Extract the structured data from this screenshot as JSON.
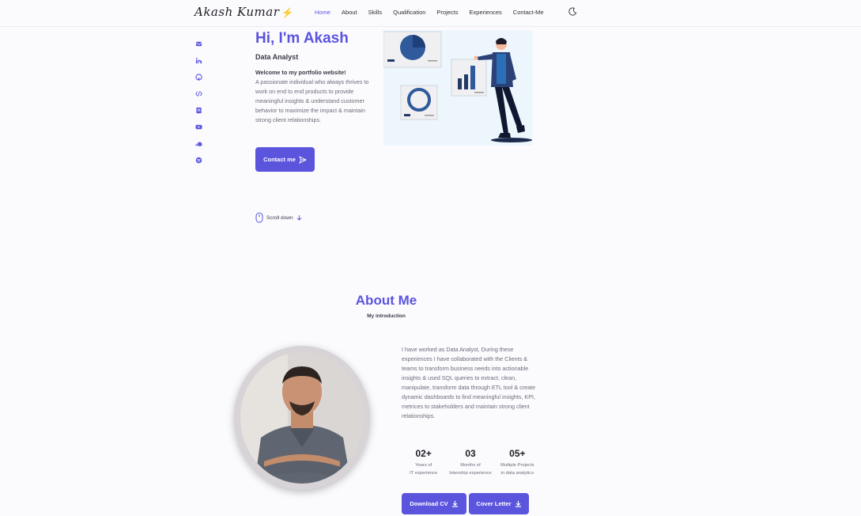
{
  "header": {
    "logo_text": "Akash Kumar",
    "logo_icon": "lightning-bolt-icon",
    "nav": [
      "Home",
      "About",
      "Skills",
      "Qualification",
      "Projects",
      "Experiences",
      "Contact-Me"
    ],
    "active_nav": "Home",
    "theme_icon": "moon-icon"
  },
  "social_icons": [
    "email-icon",
    "linkedin-icon",
    "github-icon",
    "code-icon",
    "notebook-icon",
    "youtube-icon",
    "soundcloud-icon",
    "spotify-icon"
  ],
  "hero": {
    "title": "Hi, I'm Akash",
    "subtitle": "Data Analyst",
    "welcome": "Welcome to my portfolio website!",
    "description": "A passionate individual who always thrives to work on end to end products to provide meaningful insights & understand customer behavior to maximize the impact & maintain strong client relationships.",
    "contact_button": "Contact me",
    "scroll_text": "Scroll down"
  },
  "about": {
    "title": "About Me",
    "subtitle": "My introduction",
    "description": "I have worked as Data Analyst, During these experiences I have collaborated with the Clients & teams to transform business needs into actionable insights & used SQL queries to extract, clean, manipulate, transform data through ETL tool & create dynamic dashboards to find meaningful insights, KPI, metrices to stakeholders and maintain strong client relationships.",
    "stats": [
      {
        "value": "02+",
        "label_1": "Years of",
        "label_2": "IT experience"
      },
      {
        "value": "03",
        "label_1": "Months of",
        "label_2": "Intenship experience"
      },
      {
        "value": "05+",
        "label_1": "Multiple Projects",
        "label_2": "in data analytics"
      }
    ],
    "download_cv": "Download CV",
    "cover_letter": "Cover Letter"
  },
  "colors": {
    "accent": "#5b54dd",
    "background": "#fbfbfe",
    "text": "#3a3a46"
  }
}
